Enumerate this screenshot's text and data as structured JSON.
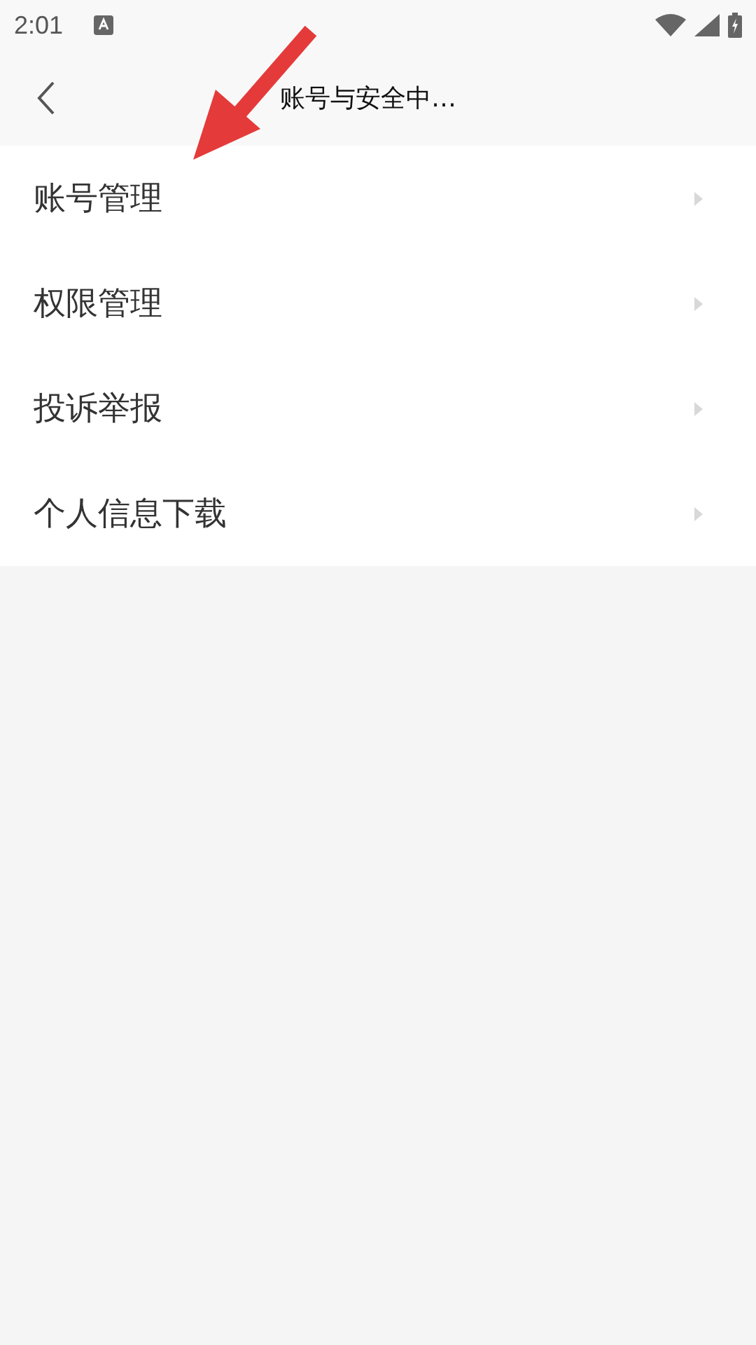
{
  "status_bar": {
    "time": "2:01"
  },
  "header": {
    "title": "账号与安全中…"
  },
  "menu_items": [
    {
      "label": "账号管理"
    },
    {
      "label": "权限管理"
    },
    {
      "label": "投诉举报"
    },
    {
      "label": "个人信息下载"
    }
  ]
}
